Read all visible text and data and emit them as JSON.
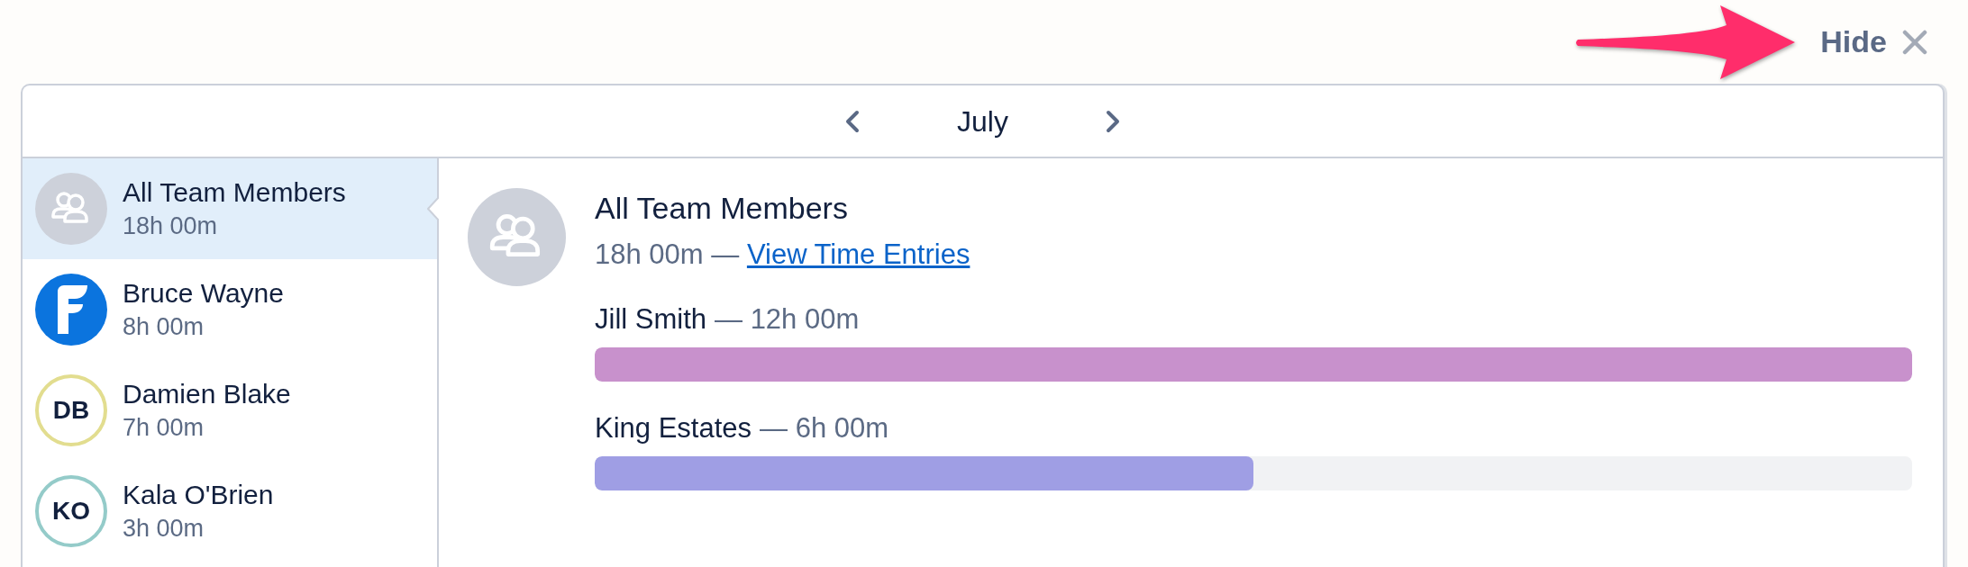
{
  "hide_button": {
    "label": "Hide"
  },
  "month_nav": {
    "month": "July"
  },
  "sidebar": {
    "items": [
      {
        "kind": "group",
        "name": "All Team Members",
        "hours": "18h 00m",
        "selected": true
      },
      {
        "kind": "logo",
        "name": "Bruce Wayne",
        "hours": "8h 00m",
        "selected": false
      },
      {
        "kind": "initials",
        "initials": "DB",
        "color": "#e2dd8f",
        "name": "Damien Blake",
        "hours": "7h 00m",
        "selected": false
      },
      {
        "kind": "initials",
        "initials": "KO",
        "color": "#94cbc9",
        "name": "Kala O'Brien",
        "hours": "3h 00m",
        "selected": false
      }
    ]
  },
  "detail": {
    "title": "All Team Members",
    "total": "18h 00m —",
    "link": "View Time Entries",
    "breakdown": [
      {
        "name": "Jill Smith",
        "hours": "— 12h 00m",
        "level": 1,
        "color": "#c891cc"
      },
      {
        "name": "King Estates",
        "hours": "— 6h 00m",
        "level": 0.5,
        "color": "#9f9ee4"
      }
    ]
  }
}
